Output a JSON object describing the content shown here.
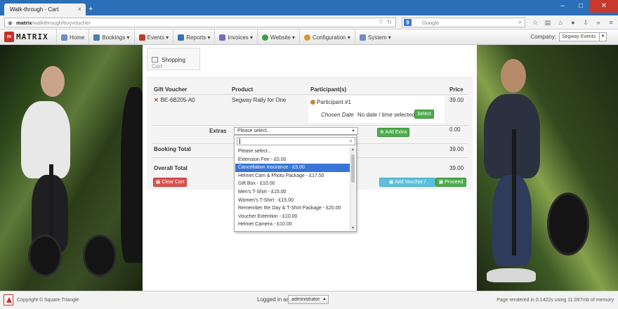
{
  "browser": {
    "tab_title": "Walk-through - Cart",
    "url_host": "matrix",
    "url_path": "/walkthrough/buyvoucher",
    "search_placeholder": "Google"
  },
  "app": {
    "logo_text": "MATRIX",
    "logo_mark": "m",
    "menu": [
      {
        "label": "Home",
        "icon": "home-icon",
        "color": "#6a8fc9"
      },
      {
        "label": "Bookings ▾",
        "icon": "bookings-icon",
        "color": "#4a7db0"
      },
      {
        "label": "Events ▾",
        "icon": "calendar-icon",
        "color": "#c0392b"
      },
      {
        "label": "Reports ▾",
        "icon": "reports-icon",
        "color": "#3a6fb0"
      },
      {
        "label": "Invoices ▾",
        "icon": "invoices-icon",
        "color": "#7a6cb6"
      },
      {
        "label": "Website ▾",
        "icon": "globe-icon",
        "color": "#3d9c45"
      },
      {
        "label": "Configuration ▾",
        "icon": "wrench-icon",
        "color": "#d49b2a"
      },
      {
        "label": "System ▾",
        "icon": "system-icon",
        "color": "#6c8ebf"
      }
    ],
    "company_label": "Company:",
    "company_value": "Segway Events"
  },
  "cart": {
    "heading_main": "Shopping",
    "heading_light": "Cart",
    "columns": {
      "gift_voucher": "Gift Voucher",
      "product": "Product",
      "participants": "Participant(s)",
      "price": "Price"
    },
    "row": {
      "voucher_code": "BE-6B205-A0",
      "product": "Segway Rally for One",
      "participant_name": "Participant #1",
      "chosen_date_label": "Chosen Date",
      "chosen_date_value": "No date / time selected.",
      "select_button": "Select",
      "price": "39.00"
    },
    "extras": {
      "label": "Extras",
      "select_value": "Please select...",
      "add_button": "Add Extra",
      "price": "0.00"
    },
    "booking_total": {
      "label": "Booking Total",
      "value": "39.00"
    },
    "overall_total": {
      "label": "Overall Total",
      "value": "39.00"
    },
    "clear_button": "Clear Cart",
    "add_voucher_button": "Add Voucher / Product",
    "proceed_button": "Proceed"
  },
  "extras_dropdown": {
    "options": [
      "Please select...",
      "Extension Fee - £0.00",
      "Cancellation Insurance - £5.00",
      "Helmet Cam & Photo Package - £17.50",
      "Gift Box - £10.00",
      "Men's T-Shirt - £15.00",
      "Women's T-Shirt - £15.00",
      "Remember the Day & T-Shirt Package - £20.00",
      "Voucher Extention - £10.00",
      "Helmet Camera - £10.00"
    ],
    "highlighted_index": 2
  },
  "footer": {
    "copyright": "Copyright © Square Triangle",
    "logged_in_label": "Logged in as:",
    "username": "administrator",
    "render_info": "Page rendered in 0.1422s using 11.097mb of memory"
  }
}
